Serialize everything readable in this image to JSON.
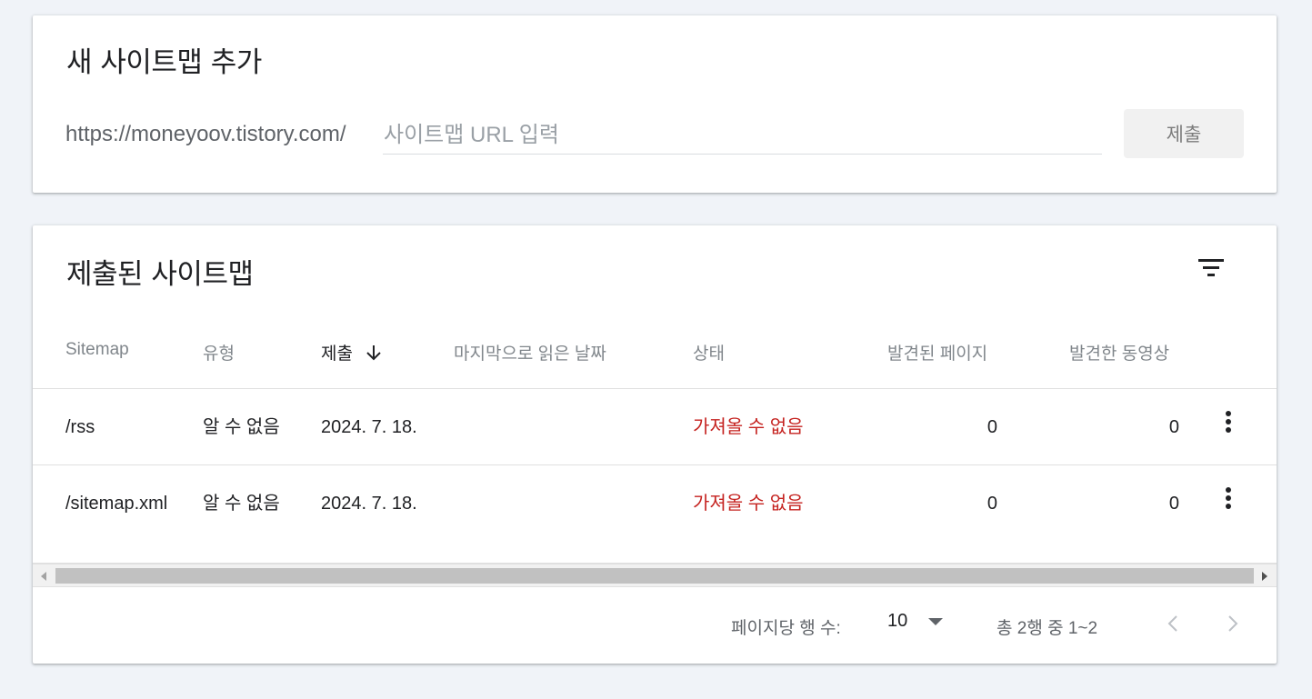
{
  "add_sitemap": {
    "title": "새 사이트맵 추가",
    "url_prefix": "https://moneyoov.tistory.com/",
    "input_value": "",
    "input_placeholder": "사이트맵 URL 입력",
    "submit_label": "제출"
  },
  "submitted": {
    "title": "제출된 사이트맵",
    "filter_icon": "filter-list-icon",
    "columns": [
      "Sitemap",
      "유형",
      "제출",
      "마지막으로 읽은 날짜",
      "상태",
      "발견된 페이지",
      "발견한 동영상"
    ],
    "sort_icon": "arrow-down-icon",
    "rows": [
      {
        "sitemap": "/rss",
        "type": "알 수 없음",
        "submitted": "2024. 7. 18.",
        "last_read": "",
        "status": "가져올 수 없음",
        "pages": "0",
        "videos": "0"
      },
      {
        "sitemap": "/sitemap.xml",
        "type": "알 수 없음",
        "submitted": "2024. 7. 18.",
        "last_read": "",
        "status": "가져올 수 없음",
        "pages": "0",
        "videos": "0"
      }
    ],
    "footer": {
      "rows_per_page_label": "페이지당 행 수:",
      "rows_per_page_value": "10",
      "range_text": "총 2행 중 1~2"
    }
  },
  "colors": {
    "background": "#f0f3f8",
    "error": "#c5221f",
    "muted": "#80868b"
  }
}
